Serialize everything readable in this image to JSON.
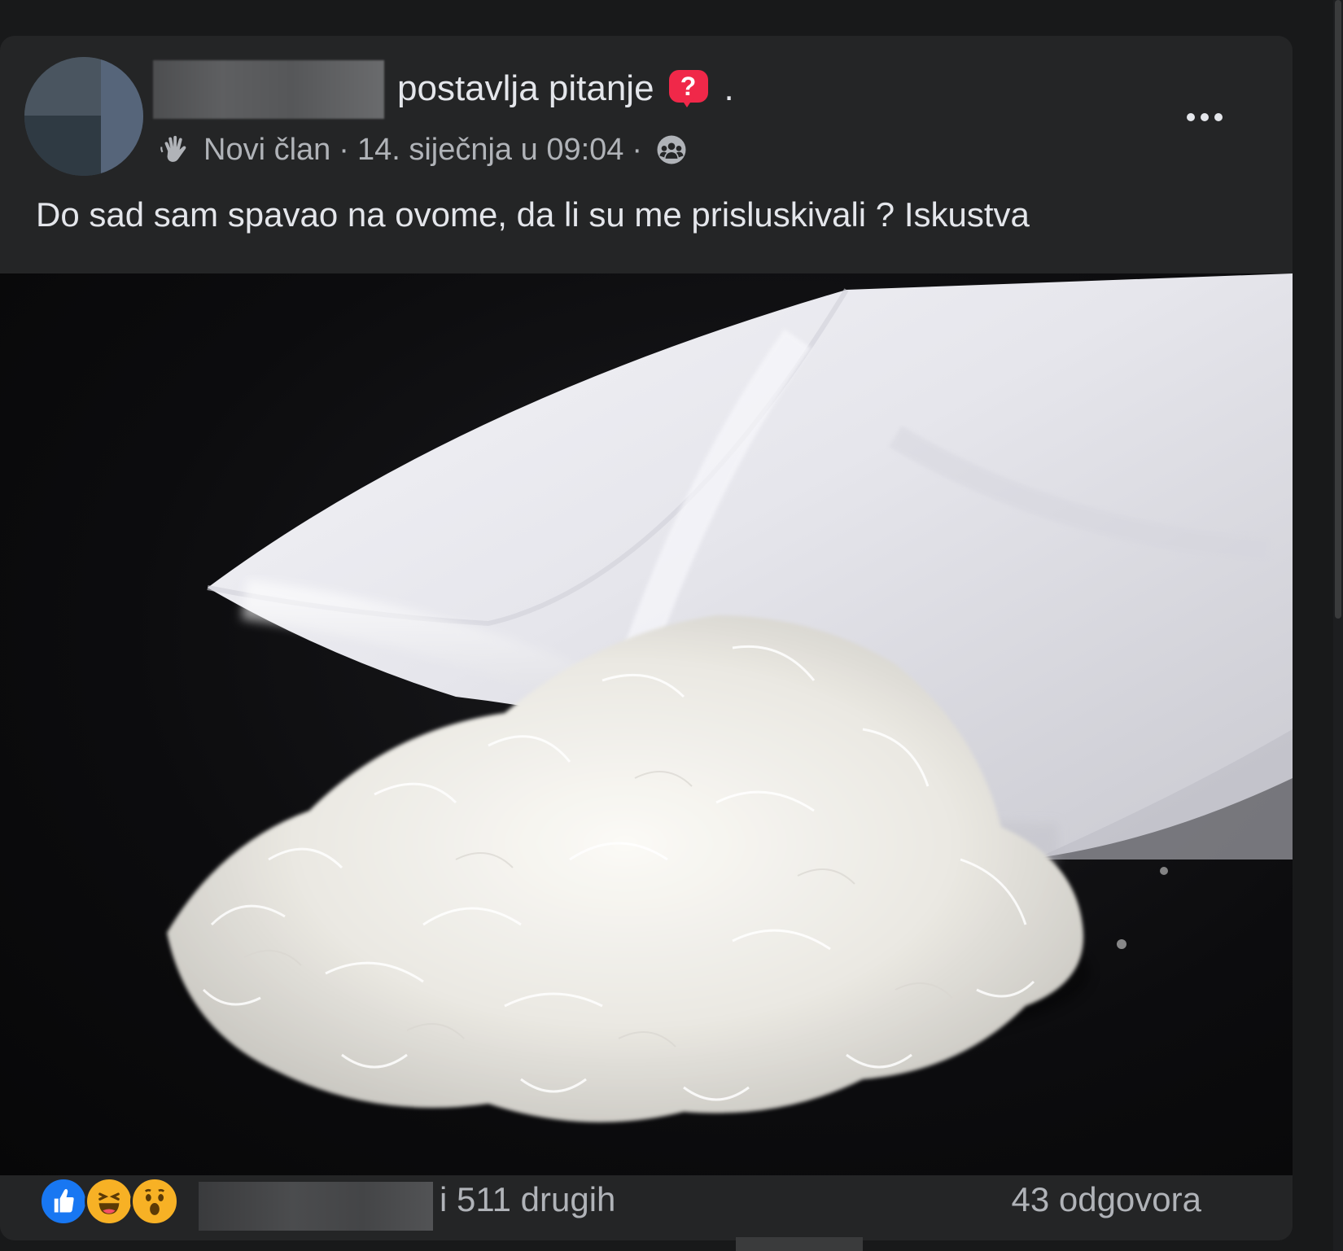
{
  "post": {
    "author_action": "postavlja pitanje",
    "trailing_dot": ".",
    "badge_glyph": "?",
    "member_label": "Novi član",
    "meta_separator": "·",
    "timestamp": "14. siječnja u 09:04",
    "text": "Do sad sam spavao na ovome, da li su me prisluskivali ? Iskustva"
  },
  "footer": {
    "others_label": "i 511 drugih",
    "answers_label": "43 odgovora"
  },
  "colors": {
    "card_bg": "#242526",
    "page_bg": "#18191a",
    "primary_text": "#e4e6eb",
    "secondary_text": "#b0b3b8",
    "question_badge": "#f02849",
    "like_blue": "#1877f2",
    "reaction_yellow": "#f7b125"
  },
  "icons": {
    "member": "waving-hand-icon",
    "privacy": "group-members-icon",
    "more": "more-options-icon",
    "reactions": [
      "like-icon",
      "haha-icon",
      "wow-icon"
    ]
  }
}
